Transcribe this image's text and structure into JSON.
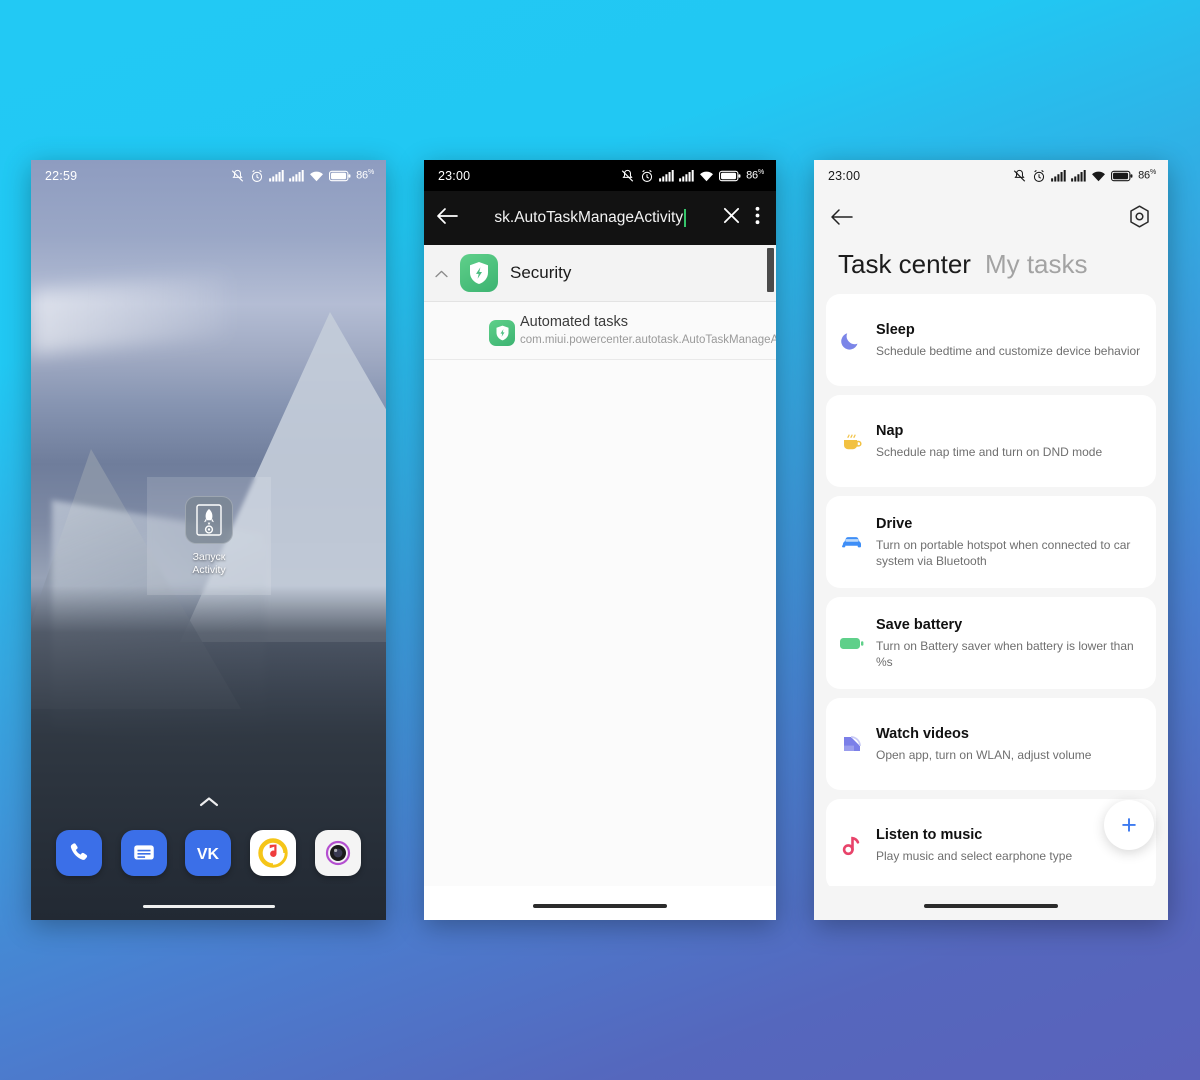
{
  "background": {
    "top_color": "#22c9f4",
    "bottom_color": "#5a62bb"
  },
  "phone1": {
    "name": "home-screen",
    "statusbar": {
      "time": "22:59",
      "battery_percent": "86",
      "percent_symbol": "%",
      "icons": [
        "mute-icon",
        "alarm-icon",
        "signal-sim1-icon",
        "signal-sim2-icon",
        "wifi-icon",
        "battery-icon"
      ]
    },
    "widget": {
      "label_line1": "Запуск",
      "label_line2": "Activity",
      "icon": "rocket-activity-icon"
    },
    "drawer_arrow": "chevron-up-icon",
    "dock": [
      {
        "name": "phone-app",
        "label": "Phone",
        "color": "#3b6fe8"
      },
      {
        "name": "messages-app",
        "label": "Messages",
        "color": "#3b6fe8"
      },
      {
        "name": "vk-app",
        "label": "VK",
        "color": "#3b6fe8"
      },
      {
        "name": "yandex-music-app",
        "label": "Yandex Music",
        "color": "#ffffff"
      },
      {
        "name": "camera-app",
        "label": "Camera",
        "color": "#f2f2f2"
      }
    ]
  },
  "phone2": {
    "name": "activity-launcher-search",
    "statusbar": {
      "time": "23:00",
      "battery_percent": "86",
      "percent_symbol": "%"
    },
    "search": {
      "back_icon": "back-arrow-icon",
      "query": "sk.AutoTaskManageActivity",
      "clear_icon": "close-icon",
      "overflow_icon": "more-vertical-icon"
    },
    "group": {
      "title": "Security",
      "collapse_icon": "chevron-up-icon",
      "app_icon": "security-shield-icon"
    },
    "results": [
      {
        "title": "Automated tasks",
        "subtitle": "com.miui.powercenter.autotask.AutoTaskManageActivity",
        "icon": "security-shield-icon"
      }
    ]
  },
  "phone3": {
    "name": "task-center",
    "statusbar": {
      "time": "23:00",
      "battery_percent": "86",
      "percent_symbol": "%"
    },
    "appbar": {
      "back_icon": "back-arrow-icon",
      "settings_icon": "gear-icon"
    },
    "tabs": [
      {
        "label": "Task center",
        "active": true
      },
      {
        "label": "My tasks",
        "active": false
      }
    ],
    "fab": {
      "icon": "plus-icon",
      "label": "+"
    },
    "tasks": [
      {
        "title": "Sleep",
        "subtitle": "Schedule bedtime and customize device behavior",
        "icon": "moon-star-icon",
        "color": "#7b85e8"
      },
      {
        "title": "Nap",
        "subtitle": "Schedule nap time and turn on DND mode",
        "icon": "coffee-cup-icon",
        "color": "#f2c141"
      },
      {
        "title": "Drive",
        "subtitle": "Turn on portable hotspot when connected to car system via Bluetooth",
        "icon": "car-icon",
        "color": "#3e8ef7"
      },
      {
        "title": "Save battery",
        "subtitle": "Turn on Battery saver when battery is lower than %s",
        "icon": "battery-icon",
        "color": "#5fd08a"
      },
      {
        "title": "Watch videos",
        "subtitle": "Open app, turn on WLAN, adjust volume",
        "icon": "video-play-icon",
        "color": "#7b7fe8"
      },
      {
        "title": "Listen to music",
        "subtitle": "Play music and select earphone type",
        "icon": "music-note-icon",
        "color": "#e8436a"
      }
    ]
  }
}
